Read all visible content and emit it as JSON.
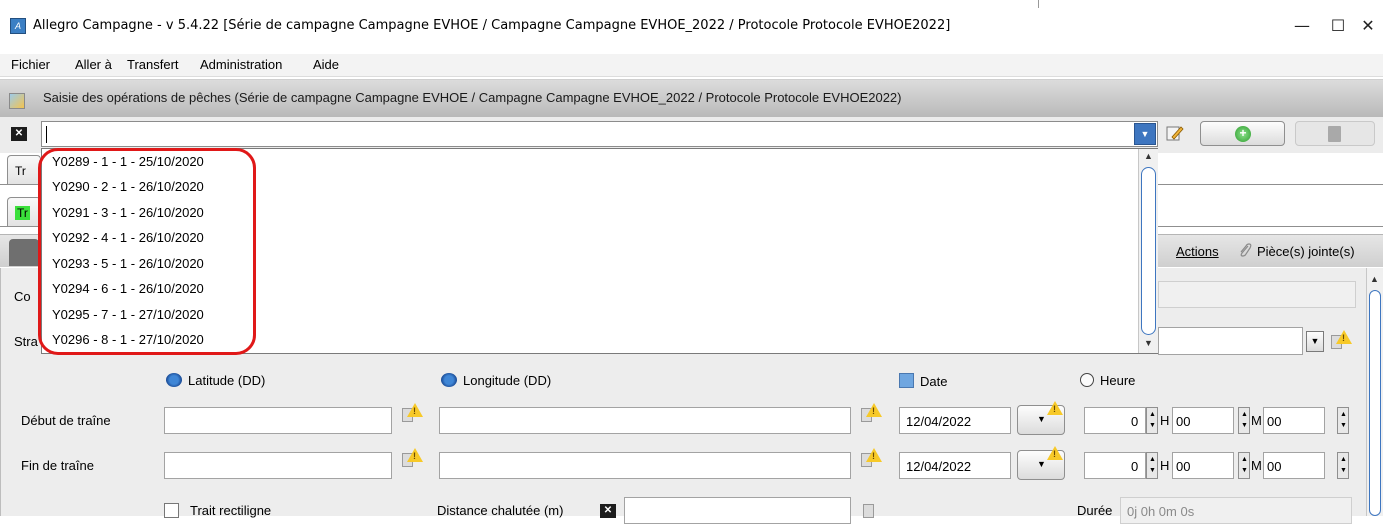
{
  "window": {
    "title": "Allegro Campagne - v 5.4.22 [Série de campagne Campagne EVHOE / Campagne Campagne EVHOE_2022 / Protocole Protocole EVHOE2022]",
    "minimize": "—",
    "maximize": "☐",
    "close": "✕"
  },
  "menu": {
    "fichier": "Fichier",
    "aller": "Aller à",
    "transfert": "Transfert",
    "administration": "Administration",
    "aide": "Aide"
  },
  "inner": {
    "title": "Saisie des opérations de pêches (Série de campagne Campagne EVHOE / Campagne Campagne EVHOE_2022 / Protocole Protocole EVHOE2022)"
  },
  "combo": {
    "value": "",
    "items": [
      "Y0289 - 1 - 1 - 25/10/2020",
      "Y0290 - 2 - 1 - 26/10/2020",
      "Y0291 - 3 - 1 - 26/10/2020",
      "Y0292 - 4 - 1 - 26/10/2020",
      "Y0293 - 5 - 1 - 26/10/2020",
      "Y0294 - 6 - 1 - 26/10/2020",
      "Y0295 - 7 - 1 - 27/10/2020",
      "Y0296 - 8 - 1 - 27/10/2020"
    ]
  },
  "tabs": {
    "tab1": "Tr",
    "tab2": "Tr"
  },
  "strip": {
    "actions": "Actions",
    "attachments": "Pièce(s) jointe(s)"
  },
  "form": {
    "code_label": "Co",
    "strate_label": "Stra",
    "latitude_header": "Latitude (DD)",
    "longitude_header": "Longitude (DD)",
    "date_header": "Date",
    "heure_header": "Heure",
    "debut_label": "Début de traîne",
    "fin_label": "Fin de traîne",
    "debut_date": "12/04/2022",
    "fin_date": "12/04/2022",
    "debut_hour": "0",
    "debut_minute": "00",
    "debut_second": "00",
    "fin_hour": "0",
    "fin_minute": "00",
    "fin_second": "00",
    "h_label": "H",
    "m_label": "M",
    "trait_label": "Trait rectiligne",
    "distance_label": "Distance chalutée (m)",
    "duree_label": "Durée",
    "duree_value": "0j 0h 0m 0s"
  }
}
